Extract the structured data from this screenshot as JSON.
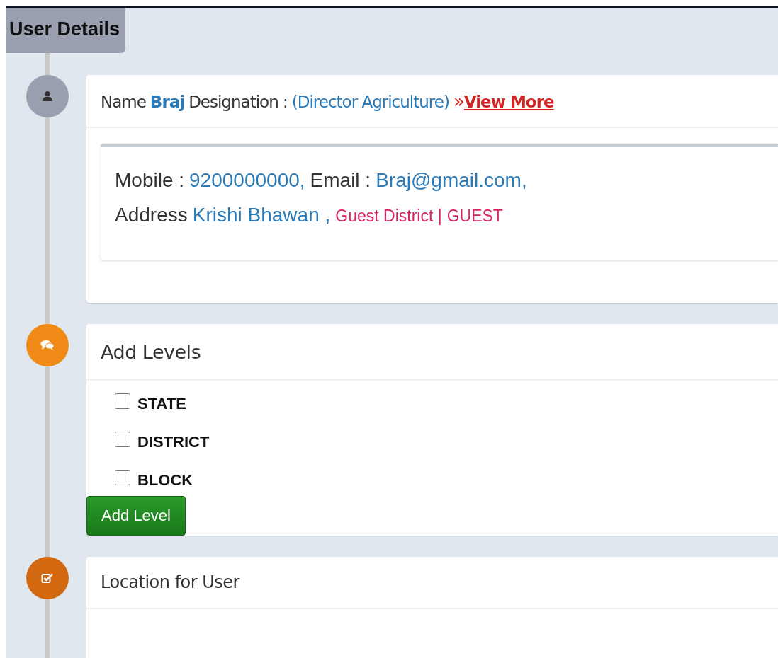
{
  "page_tab": {
    "label": "User Details"
  },
  "sections": [
    {
      "kind": "profile",
      "color": "#9aa0b0",
      "name_label": "Name",
      "name": "Braj",
      "designation_label": "Designation :",
      "designation": "(Director Agriculture)",
      "chevron": "»",
      "link": "View More",
      "details": {
        "mobile_label": "Mobile :",
        "mobile": "9200000000,",
        "email_label": "Email :",
        "email": "Braj@gmail.com,",
        "address_label": "Address",
        "address": "Krishi Bhawan ,",
        "district": "Guest District |",
        "role": "GUEST"
      }
    },
    {
      "kind": "levels",
      "color": "#ef8a17",
      "title": "Add Levels",
      "options": [
        {
          "label": "STATE",
          "checked": false
        },
        {
          "label": "DISTRICT",
          "checked": false
        },
        {
          "label": "BLOCK",
          "checked": false
        }
      ],
      "button": "Add Level"
    },
    {
      "kind": "location",
      "color": "#d2680f",
      "title": "Location for User"
    }
  ]
}
